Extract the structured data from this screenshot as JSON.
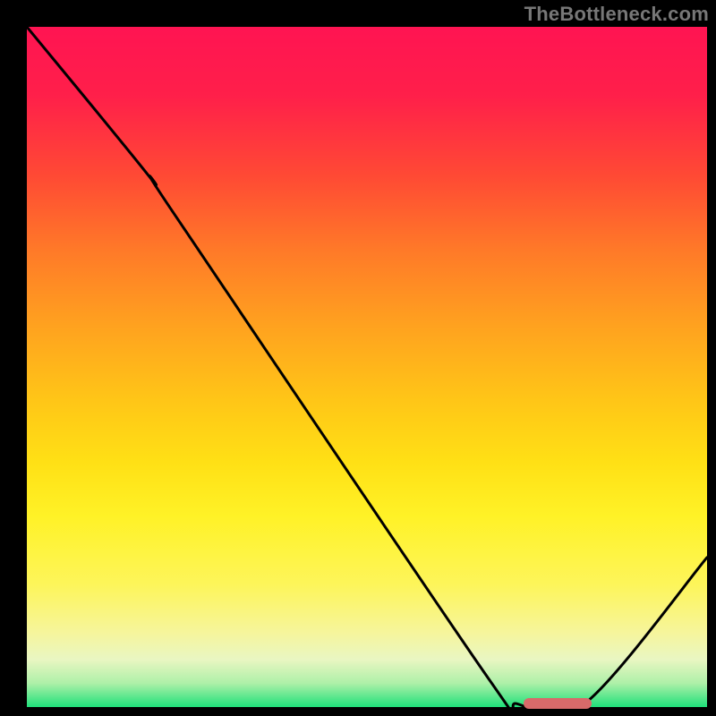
{
  "watermark": "TheBottleneck.com",
  "chart_data": {
    "type": "line",
    "title": "",
    "xlabel": "",
    "ylabel": "",
    "xlim": [
      0,
      100
    ],
    "ylim": [
      0,
      100
    ],
    "grid": false,
    "series": [
      {
        "name": "curve",
        "points": [
          {
            "x": 0,
            "y": 100
          },
          {
            "x": 18,
            "y": 78
          },
          {
            "x": 22,
            "y": 72
          },
          {
            "x": 68,
            "y": 4
          },
          {
            "x": 72,
            "y": 0.5
          },
          {
            "x": 82,
            "y": 0.5
          },
          {
            "x": 100,
            "y": 22
          }
        ]
      }
    ],
    "marker": {
      "x_start": 73,
      "x_end": 83,
      "y": 0.5
    },
    "gradient_stops": [
      {
        "pos": 0,
        "color": "#ff1452"
      },
      {
        "pos": 0.5,
        "color": "#ffc617"
      },
      {
        "pos": 0.85,
        "color": "#fdf55a"
      },
      {
        "pos": 1.0,
        "color": "#1fe07a"
      }
    ]
  }
}
